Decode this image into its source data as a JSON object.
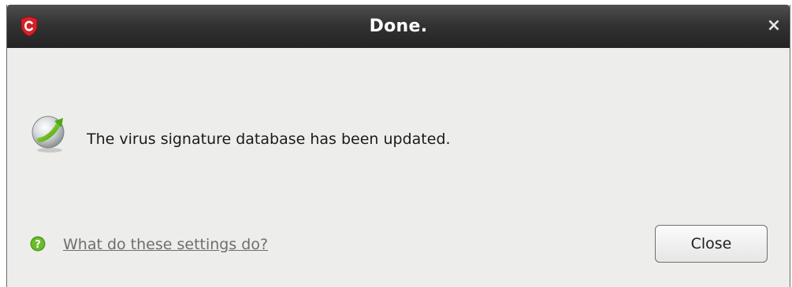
{
  "window": {
    "title": "Done.",
    "close_glyph": "×",
    "app_icon": "comodo-shield-icon",
    "accent_color": "#d42128"
  },
  "body": {
    "icon": "update-complete-icon",
    "message": "The virus signature database has been updated."
  },
  "footer": {
    "help_icon": "help-question-icon",
    "help_link": "What do these settings do?",
    "close_label": "Close"
  }
}
